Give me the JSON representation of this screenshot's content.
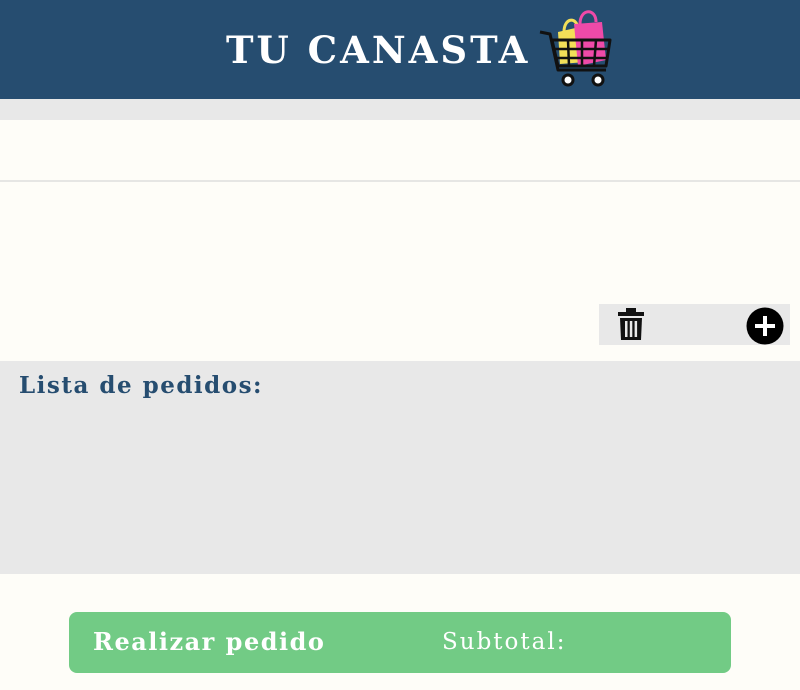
{
  "header": {
    "title": "TU CANASTA",
    "logo_icon": "shopping-cart-icon",
    "background": "#264d70"
  },
  "actions": {
    "delete_icon": "trash-icon",
    "add_icon": "plus-circle-icon"
  },
  "orders": {
    "title": "Lista de pedidos:"
  },
  "footer": {
    "order_button_label": "Realizar pedido",
    "subtotal_label": "Subtotal:",
    "accent": "#72cb85"
  }
}
